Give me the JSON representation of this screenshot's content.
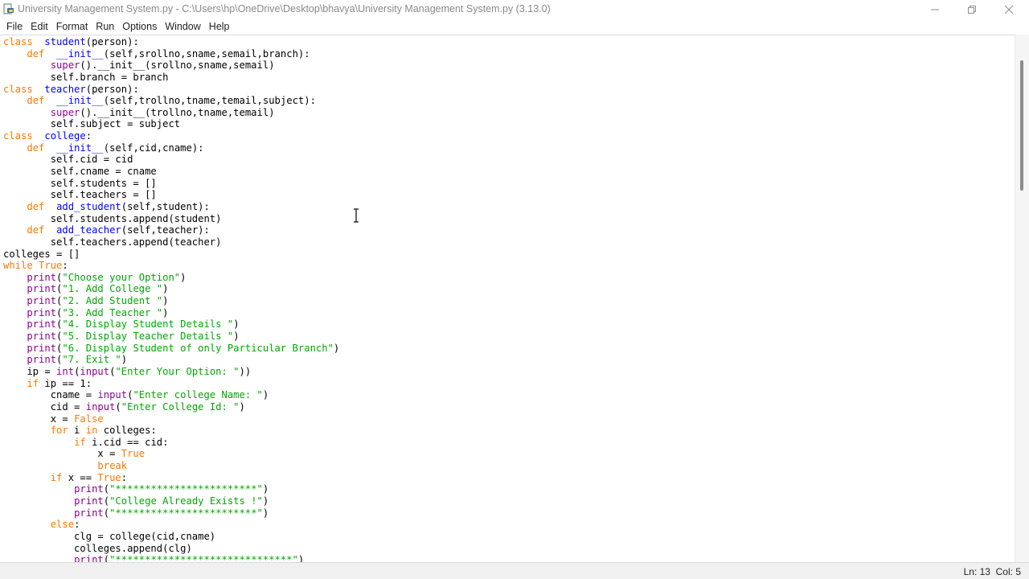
{
  "window": {
    "title": "University Management System.py - C:\\Users\\hp\\OneDrive\\Desktop\\bhavya\\University Management System.py (3.13.0)",
    "icon": "python-idle-icon"
  },
  "menu": [
    "File",
    "Edit",
    "Format",
    "Run",
    "Options",
    "Window",
    "Help"
  ],
  "editor": {
    "lines": [
      [
        [
          "kw",
          "class"
        ],
        [
          "",
          "  "
        ],
        [
          "df",
          "student"
        ],
        [
          "",
          "(person):"
        ]
      ],
      [
        [
          "",
          "    "
        ],
        [
          "kw",
          "def"
        ],
        [
          "",
          "  "
        ],
        [
          "df",
          "__init__"
        ],
        [
          "",
          "(self,srollno,sname,semail,branch):"
        ]
      ],
      [
        [
          "",
          "        "
        ],
        [
          "bi",
          "super"
        ],
        [
          "",
          "()."
        ],
        [
          "",
          "__init__(srollno,sname,semail)"
        ]
      ],
      [
        [
          "",
          "        self.branch = branch"
        ]
      ],
      [
        [
          "kw",
          "class"
        ],
        [
          "",
          "  "
        ],
        [
          "df",
          "teacher"
        ],
        [
          "",
          "(person):"
        ]
      ],
      [
        [
          "",
          "    "
        ],
        [
          "kw",
          "def"
        ],
        [
          "",
          "  "
        ],
        [
          "df",
          "__init__"
        ],
        [
          "",
          "(self,trollno,tname,temail,subject):"
        ]
      ],
      [
        [
          "",
          "        "
        ],
        [
          "bi",
          "super"
        ],
        [
          "",
          "()."
        ],
        [
          "",
          "__init__(trollno,tname,temail)"
        ]
      ],
      [
        [
          "",
          "        self.subject = subject"
        ]
      ],
      [
        [
          "kw",
          "class"
        ],
        [
          "",
          "  "
        ],
        [
          "df",
          "college"
        ],
        [
          "",
          ":"
        ]
      ],
      [
        [
          "",
          "    "
        ],
        [
          "kw",
          "def"
        ],
        [
          "",
          "  "
        ],
        [
          "df",
          "__init__"
        ],
        [
          "",
          "(self,cid,cname):"
        ]
      ],
      [
        [
          "",
          "        self.cid = cid"
        ]
      ],
      [
        [
          "",
          "        self.cname = cname"
        ]
      ],
      [
        [
          "",
          "        self.students = []"
        ]
      ],
      [
        [
          "",
          "        self.teachers = []"
        ]
      ],
      [
        [
          "",
          "    "
        ],
        [
          "kw",
          "def"
        ],
        [
          "",
          "  "
        ],
        [
          "df",
          "add_student"
        ],
        [
          "",
          "(self,student):"
        ]
      ],
      [
        [
          "",
          "        self.students.append(student)"
        ]
      ],
      [
        [
          "",
          "    "
        ],
        [
          "kw",
          "def"
        ],
        [
          "",
          "  "
        ],
        [
          "df",
          "add_teacher"
        ],
        [
          "",
          "(self,teacher):"
        ]
      ],
      [
        [
          "",
          "        self.teachers.append(teacher)"
        ]
      ],
      [
        [
          "",
          "colleges = []"
        ]
      ],
      [
        [
          "kw",
          "while"
        ],
        [
          "",
          " "
        ],
        [
          "kw",
          "True"
        ],
        [
          "",
          ":"
        ]
      ],
      [
        [
          "",
          "    "
        ],
        [
          "bi",
          "print"
        ],
        [
          "",
          "("
        ],
        [
          "st",
          "\"Choose your Option\""
        ],
        [
          "",
          ")"
        ]
      ],
      [
        [
          "",
          "    "
        ],
        [
          "bi",
          "print"
        ],
        [
          "",
          "("
        ],
        [
          "st",
          "\"1. Add College \""
        ],
        [
          "",
          ")"
        ]
      ],
      [
        [
          "",
          "    "
        ],
        [
          "bi",
          "print"
        ],
        [
          "",
          "("
        ],
        [
          "st",
          "\"2. Add Student \""
        ],
        [
          "",
          ")"
        ]
      ],
      [
        [
          "",
          "    "
        ],
        [
          "bi",
          "print"
        ],
        [
          "",
          "("
        ],
        [
          "st",
          "\"3. Add Teacher \""
        ],
        [
          "",
          ")"
        ]
      ],
      [
        [
          "",
          "    "
        ],
        [
          "bi",
          "print"
        ],
        [
          "",
          "("
        ],
        [
          "st",
          "\"4. Display Student Details \""
        ],
        [
          "",
          ")"
        ]
      ],
      [
        [
          "",
          "    "
        ],
        [
          "bi",
          "print"
        ],
        [
          "",
          "("
        ],
        [
          "st",
          "\"5. Display Teacher Details \""
        ],
        [
          "",
          ")"
        ]
      ],
      [
        [
          "",
          "    "
        ],
        [
          "bi",
          "print"
        ],
        [
          "",
          "("
        ],
        [
          "st",
          "\"6. Display Student of only Particular Branch\""
        ],
        [
          "",
          ")"
        ]
      ],
      [
        [
          "",
          "    "
        ],
        [
          "bi",
          "print"
        ],
        [
          "",
          "("
        ],
        [
          "st",
          "\"7. Exit \""
        ],
        [
          "",
          ")"
        ]
      ],
      [
        [
          "",
          "    ip = "
        ],
        [
          "bi",
          "int"
        ],
        [
          "",
          "("
        ],
        [
          "bi",
          "input"
        ],
        [
          "",
          "("
        ],
        [
          "st",
          "\"Enter Your Option: \""
        ],
        [
          "",
          "))"
        ]
      ],
      [
        [
          "",
          "    "
        ],
        [
          "kw",
          "if"
        ],
        [
          "",
          " ip == 1:"
        ]
      ],
      [
        [
          "",
          "        cname = "
        ],
        [
          "bi",
          "input"
        ],
        [
          "",
          "("
        ],
        [
          "st",
          "\"Enter college Name: \""
        ],
        [
          "",
          ")"
        ]
      ],
      [
        [
          "",
          "        cid = "
        ],
        [
          "bi",
          "input"
        ],
        [
          "",
          "("
        ],
        [
          "st",
          "\"Enter College Id: \""
        ],
        [
          "",
          ")"
        ]
      ],
      [
        [
          "",
          "        x = "
        ],
        [
          "kw",
          "False"
        ]
      ],
      [
        [
          "",
          "        "
        ],
        [
          "kw",
          "for"
        ],
        [
          "",
          " i "
        ],
        [
          "kw",
          "in"
        ],
        [
          "",
          " colleges:"
        ]
      ],
      [
        [
          "",
          "            "
        ],
        [
          "kw",
          "if"
        ],
        [
          "",
          " i.cid == cid:"
        ]
      ],
      [
        [
          "",
          "                x = "
        ],
        [
          "kw",
          "True"
        ]
      ],
      [
        [
          "",
          "                "
        ],
        [
          "kw",
          "break"
        ]
      ],
      [
        [
          "",
          "        "
        ],
        [
          "kw",
          "if"
        ],
        [
          "",
          " x == "
        ],
        [
          "kw",
          "True"
        ],
        [
          "",
          ":"
        ]
      ],
      [
        [
          "",
          "            "
        ],
        [
          "bi",
          "print"
        ],
        [
          "",
          "("
        ],
        [
          "st",
          "\"************************\""
        ],
        [
          "",
          ")"
        ]
      ],
      [
        [
          "",
          "            "
        ],
        [
          "bi",
          "print"
        ],
        [
          "",
          "("
        ],
        [
          "st",
          "\"College Already Exists !\""
        ],
        [
          "",
          ")"
        ]
      ],
      [
        [
          "",
          "            "
        ],
        [
          "bi",
          "print"
        ],
        [
          "",
          "("
        ],
        [
          "st",
          "\"************************\""
        ],
        [
          "",
          ")"
        ]
      ],
      [
        [
          "",
          "        "
        ],
        [
          "kw",
          "else"
        ],
        [
          "",
          ":"
        ]
      ],
      [
        [
          "",
          "            clg = college(cid,cname)"
        ]
      ],
      [
        [
          "",
          "            colleges.append(clg)"
        ]
      ],
      [
        [
          "",
          "            "
        ],
        [
          "bi",
          "print"
        ],
        [
          "",
          "("
        ],
        [
          "st",
          "\"******************************\""
        ],
        [
          "",
          ")"
        ]
      ]
    ]
  },
  "status": {
    "line": "Ln: 13",
    "col": "Col: 5"
  },
  "colors": {
    "keyword": "#ff7700",
    "builtin": "#900090",
    "string": "#00aa00",
    "definition": "#0000ff"
  }
}
